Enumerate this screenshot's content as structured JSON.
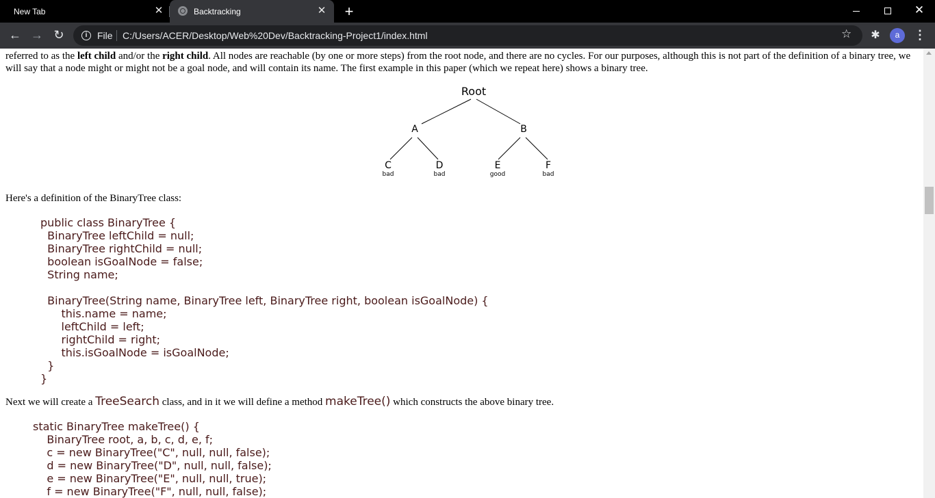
{
  "browser": {
    "tabs": [
      {
        "title": "New Tab",
        "active": false
      },
      {
        "title": "Backtracking",
        "active": true
      }
    ],
    "new_tab_symbol": "+",
    "close_symbol": "✕",
    "address": {
      "scheme_label": "File",
      "url": "C:/Users/ACER/Desktop/Web%20Dev/Backtracking-Project1/index.html"
    },
    "profile_initial": "a",
    "icons": [
      "back-arrow-icon",
      "forward-arrow-icon",
      "reload-icon",
      "info-icon",
      "star-icon",
      "extensions-puzzle-icon",
      "kebab-menu-icon"
    ]
  },
  "article": {
    "para1": {
      "t1": "referred to as the ",
      "b1": "left child",
      "t2": " and/or the ",
      "b2": "right child",
      "t3": ". All nodes are reachable (by one or more steps) from the root node, and there are no cycles. For our purposes, although this is not part of the definition of a binary tree, we will say that a node might or might not be a goal node, and will contain its name. The first example in this paper (which we repeat here) shows a binary tree."
    },
    "tree": {
      "root": "Root",
      "a": "A",
      "b": "B",
      "c": {
        "label": "C",
        "status": "bad"
      },
      "d": {
        "label": "D",
        "status": "bad"
      },
      "e": {
        "label": "E",
        "status": "good"
      },
      "f": {
        "label": "F",
        "status": "bad"
      }
    },
    "para2": "Here's a definition of the BinaryTree class:",
    "code1": "public class BinaryTree {\n  BinaryTree leftChild = null;\n  BinaryTree rightChild = null;\n  boolean isGoalNode = false;\n  String name;\n\n  BinaryTree(String name, BinaryTree left, BinaryTree right, boolean isGoalNode) {\n      this.name = name;\n      leftChild = left;\n      rightChild = right;\n      this.isGoalNode = isGoalNode;\n  }\n}",
    "para3": {
      "t1": "Next we will create a ",
      "c1": "TreeSearch",
      "t2": " class, and in it we will define a method ",
      "c2": "makeTree()",
      "t3": " which constructs the above binary tree."
    },
    "code2": "static BinaryTree makeTree() {\n    BinaryTree root, a, b, c, d, e, f;\n    c = new BinaryTree(\"C\", null, null, false);\n    d = new BinaryTree(\"D\", null, null, false);\n    e = new BinaryTree(\"E\", null, null, true);\n    f = new BinaryTree(\"F\", null, null, false);"
  }
}
